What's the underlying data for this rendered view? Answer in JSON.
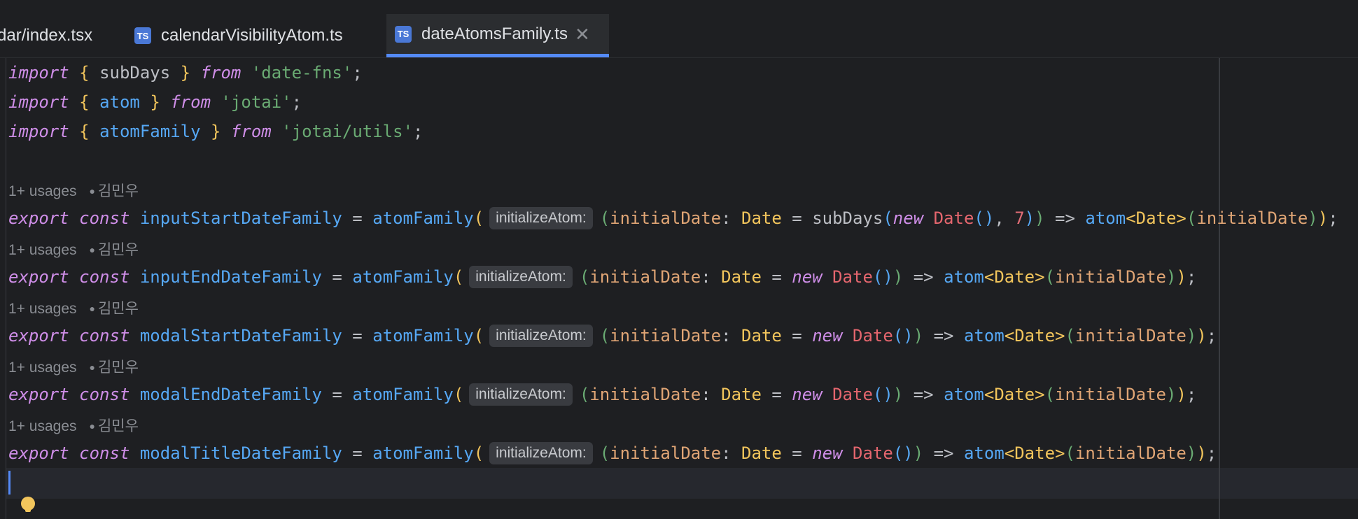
{
  "tabs": [
    {
      "label": "dar/index.tsx",
      "icon": ""
    },
    {
      "label": "calendarVisibilityAtom.ts",
      "icon": "ts-icon"
    },
    {
      "label": "dateAtomsFamily.ts",
      "icon": "ts-icon",
      "active": true
    }
  ],
  "ts_badge": "TS",
  "close_glyph": "✕",
  "code": {
    "imports": [
      {
        "kw": "import",
        "open": "{",
        "name": "subDays",
        "close": "}",
        "from": "from",
        "module": "'date-fns'",
        "end": ";"
      },
      {
        "kw": "import",
        "open": "{",
        "name": "atom",
        "close": "}",
        "from": "from",
        "module": "'jotai'",
        "end": ";"
      },
      {
        "kw": "import",
        "open": "{",
        "name": "atomFamily",
        "close": "}",
        "from": "from",
        "module": "'jotai/utils'",
        "end": ";"
      }
    ],
    "hint_usages": "1+ usages",
    "hint_author": "김민우",
    "inlay_hint": "initializeAtom:",
    "tokens": {
      "export": "export",
      "const": "const",
      "eq": "=",
      "atomFamily": "atomFamily",
      "open_paren": "(",
      "param": "initialDate",
      "colon": ":",
      "type": "Date",
      "new": "new",
      "date_ctor": "Date",
      "call": "()",
      "arrow": "=>",
      "atom": "atom",
      "generic": "<Date>",
      "close": ");",
      "subDays": "subDays",
      "comma": ",",
      "seven": "7"
    },
    "declarations": [
      {
        "name": "inputStartDateFamily",
        "default": "subDays"
      },
      {
        "name": "inputEndDateFamily",
        "default": "new"
      },
      {
        "name": "modalStartDateFamily",
        "default": "new"
      },
      {
        "name": "modalEndDateFamily",
        "default": "new"
      },
      {
        "name": "modalTitleDateFamily",
        "default": "new"
      }
    ]
  },
  "colors": {
    "background": "#1e1f22",
    "keyword": "#cf8ee8",
    "string": "#6aab73",
    "function": "#56a8f5",
    "accent": "#548af7"
  }
}
